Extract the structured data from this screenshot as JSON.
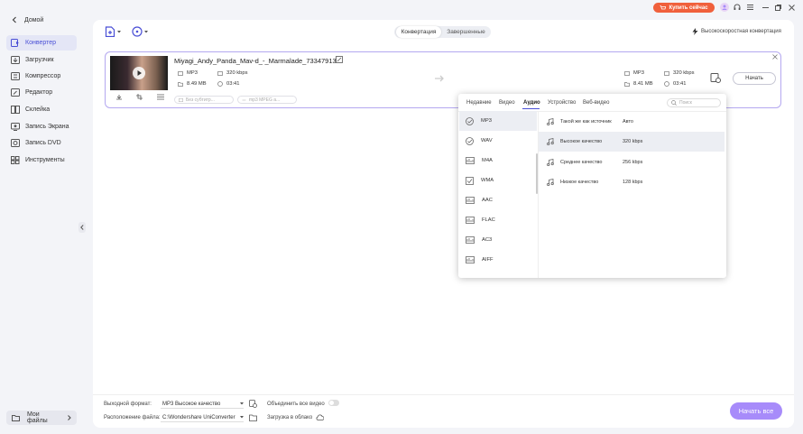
{
  "titlebar": {
    "buy_label": "Купить сейчас",
    "window_controls": [
      "user-icon",
      "headset-icon",
      "menu-icon",
      "minimize-icon",
      "maximize-icon",
      "close-icon"
    ]
  },
  "sidebar": {
    "home_label": "Домой",
    "items": [
      {
        "label": "Конвертер",
        "icon": "converter-icon",
        "active": true
      },
      {
        "label": "Загрузчик",
        "icon": "download-icon"
      },
      {
        "label": "Компрессор",
        "icon": "compress-icon"
      },
      {
        "label": "Редактор",
        "icon": "edit-icon"
      },
      {
        "label": "Склейка",
        "icon": "merge-icon"
      },
      {
        "label": "Запись Экрана",
        "icon": "screen-record-icon"
      },
      {
        "label": "Запись DVD",
        "icon": "dvd-icon"
      },
      {
        "label": "Инструменты",
        "icon": "tools-icon"
      }
    ],
    "my_files_label": "Мои файлы"
  },
  "toolbar": {
    "tab_convert": "Конвертация",
    "tab_done": "Завершенные",
    "hs_label": "Высокоскоростная конвертация"
  },
  "file": {
    "name": "Miyagi_Andy_Panda_Mav-d_-_Marmalade_73347913",
    "src_format": "MP3",
    "src_bitrate": "320 kbps",
    "src_size": "8.49 MB",
    "src_duration": "03:41",
    "dst_format": "MP3",
    "dst_bitrate": "320 kbps",
    "dst_size": "8.41 MB",
    "dst_duration": "03:41",
    "subtitle_dd": "Без субтитр...",
    "audio_dd": "mp3 MPEG a...",
    "start_label": "Начать"
  },
  "popup": {
    "tabs": [
      "Недавние",
      "Видео",
      "Аудио",
      "Устройство",
      "Веб-видео"
    ],
    "active_tab": "Аудио",
    "search_placeholder": "Поиск",
    "formats": [
      "MP3",
      "WAV",
      "M4A",
      "WMA",
      "AAC",
      "FLAC",
      "AC3",
      "AIFF"
    ],
    "qualities": [
      {
        "name": "Такой же как источник",
        "value": "Авто"
      },
      {
        "name": "Высокое качество",
        "value": "320 kbps"
      },
      {
        "name": "Среднее качество",
        "value": "256 kbps"
      },
      {
        "name": "Низкое качество",
        "value": "128 kbps"
      }
    ]
  },
  "bottom": {
    "output_format_label": "Выходной формат:",
    "output_format_value": "MP3 Высокое качество",
    "merge_label": "Объединить все видео",
    "location_label": "Расположение файла:",
    "location_value": "C:\\Wondershare UniConverter",
    "cloud_label": "Загрузка в облако",
    "convert_all_label": "Начать все"
  },
  "colors": {
    "accent": "#4a4fd6",
    "purple": "#a78bfa",
    "buy": "#f0603c"
  }
}
